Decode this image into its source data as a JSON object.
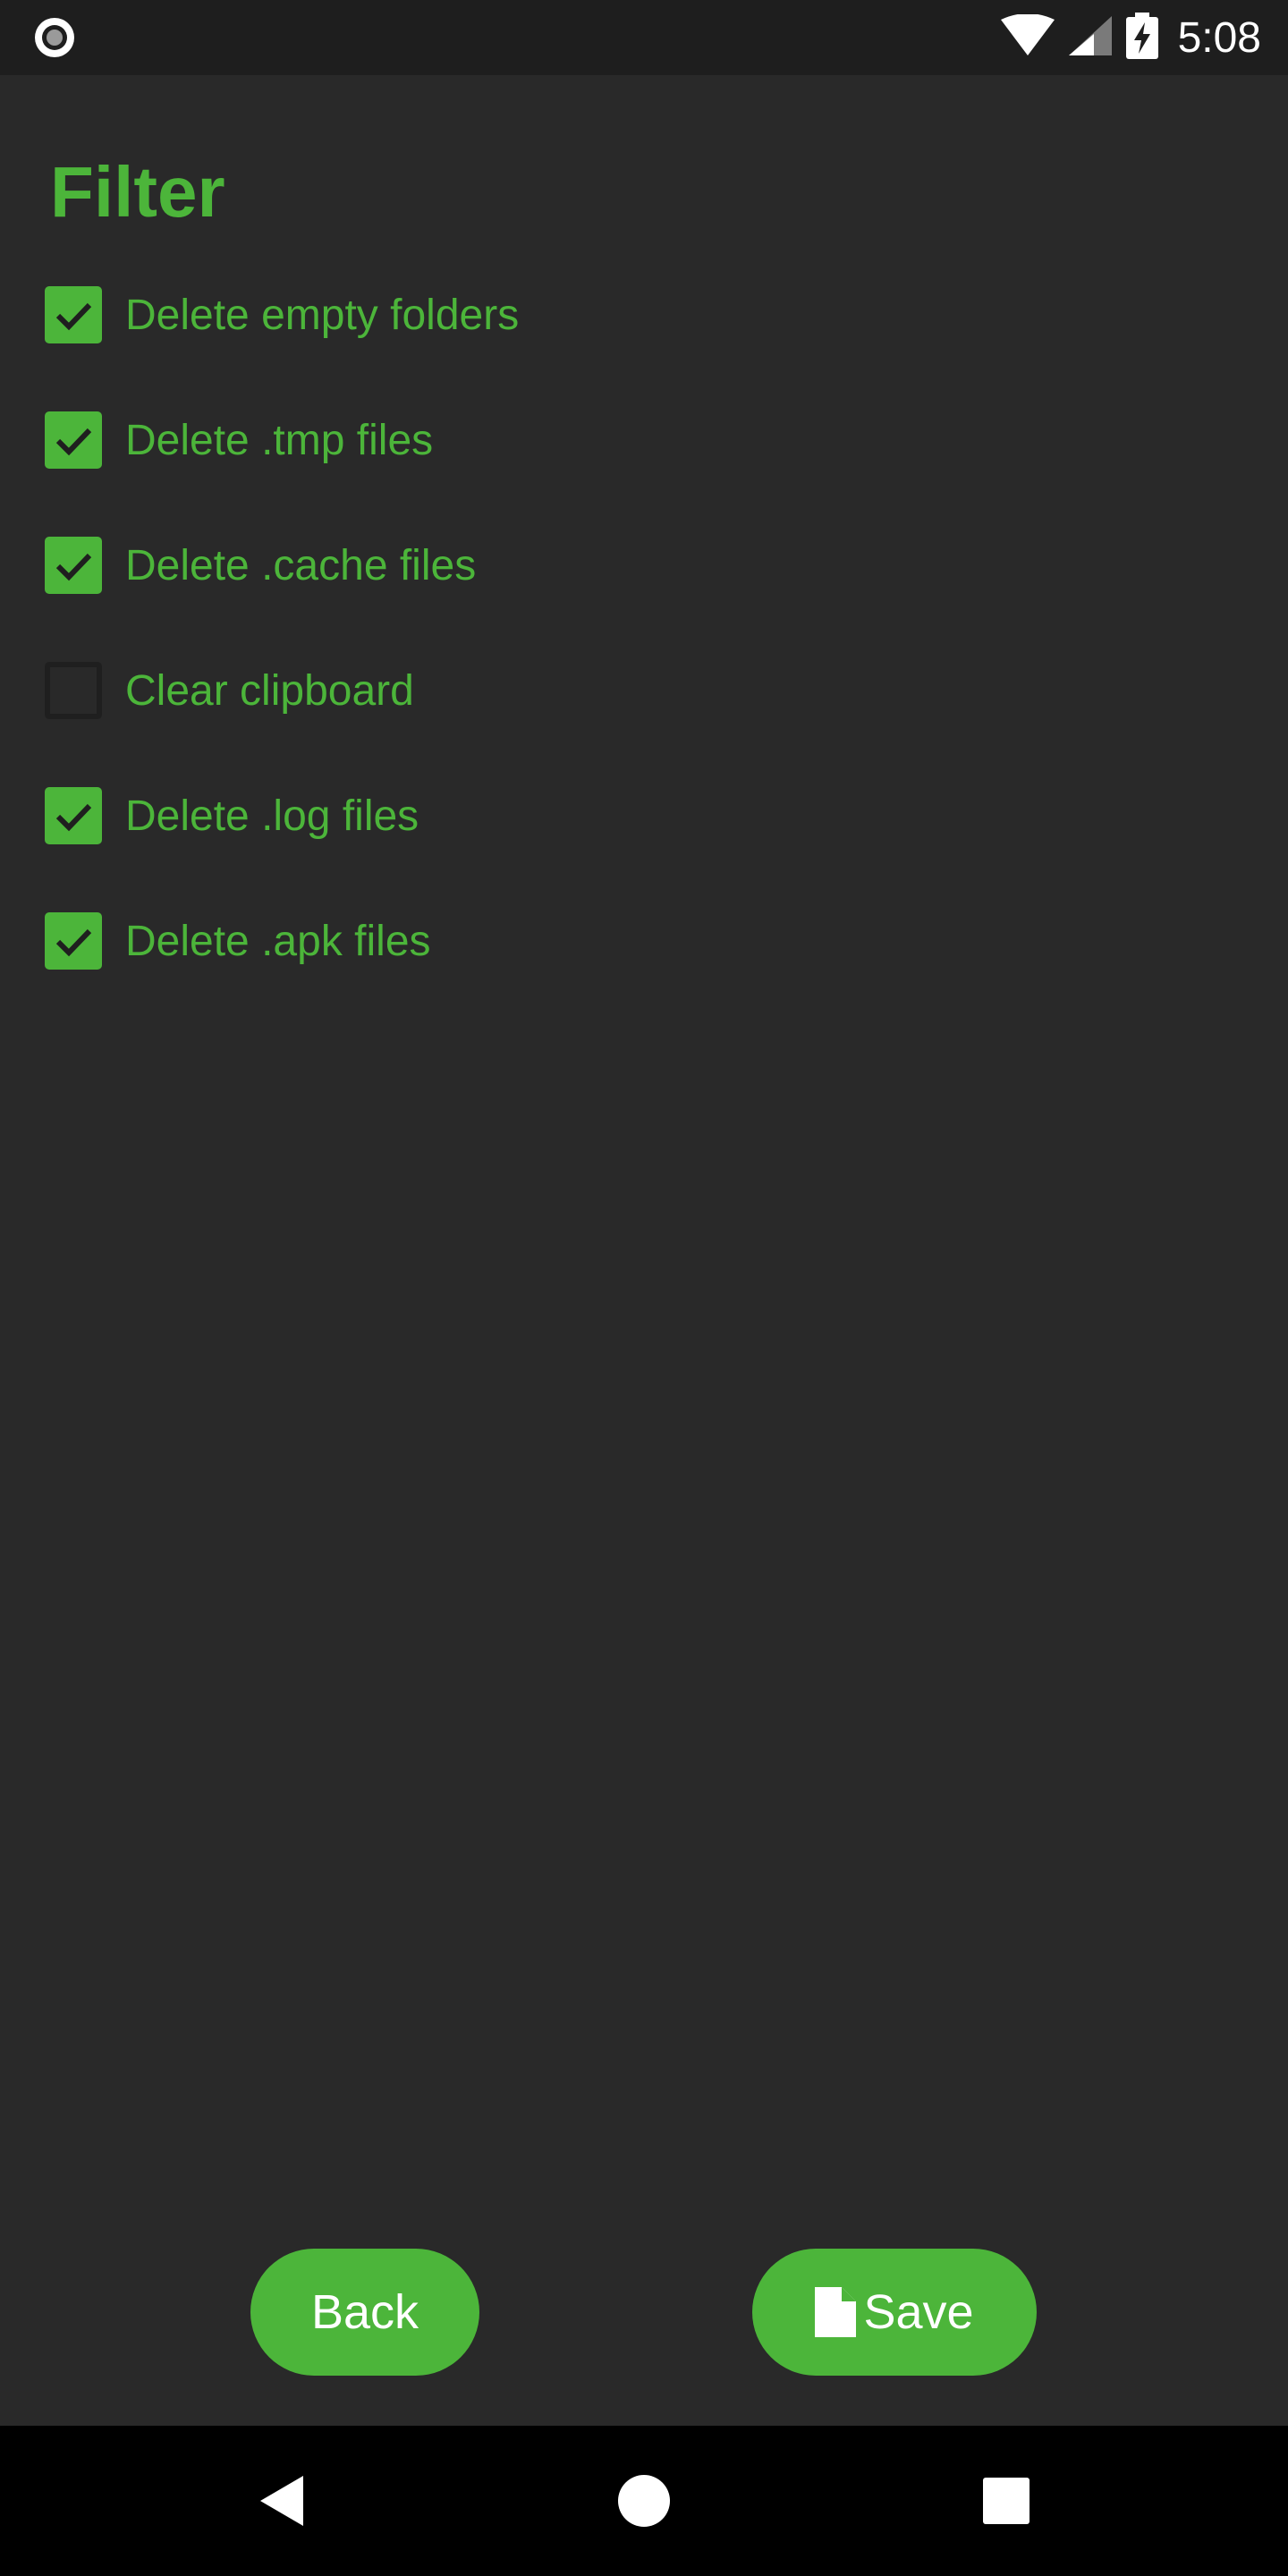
{
  "status_bar": {
    "time": "5:08",
    "left_icon": "record-circle-icon",
    "icons": [
      "wifi-icon",
      "signal-icon",
      "battery-charging-icon"
    ]
  },
  "page": {
    "title": "Filter"
  },
  "filters": [
    {
      "label": "Delete empty folders",
      "checked": true
    },
    {
      "label": "Delete .tmp files",
      "checked": true
    },
    {
      "label": "Delete .cache files",
      "checked": true
    },
    {
      "label": "Clear clipboard",
      "checked": false
    },
    {
      "label": "Delete .log files",
      "checked": true
    },
    {
      "label": "Delete .apk files",
      "checked": true
    }
  ],
  "buttons": {
    "back_label": "Back",
    "save_label": "Save",
    "save_icon": "file-icon"
  },
  "nav_bar": {
    "icons": [
      "back-triangle-icon",
      "home-circle-icon",
      "recents-square-icon"
    ]
  },
  "colors": {
    "accent": "#4cb53a",
    "background": "#292929",
    "status_bar": "#1e1e1e",
    "nav_bar": "#000000"
  }
}
